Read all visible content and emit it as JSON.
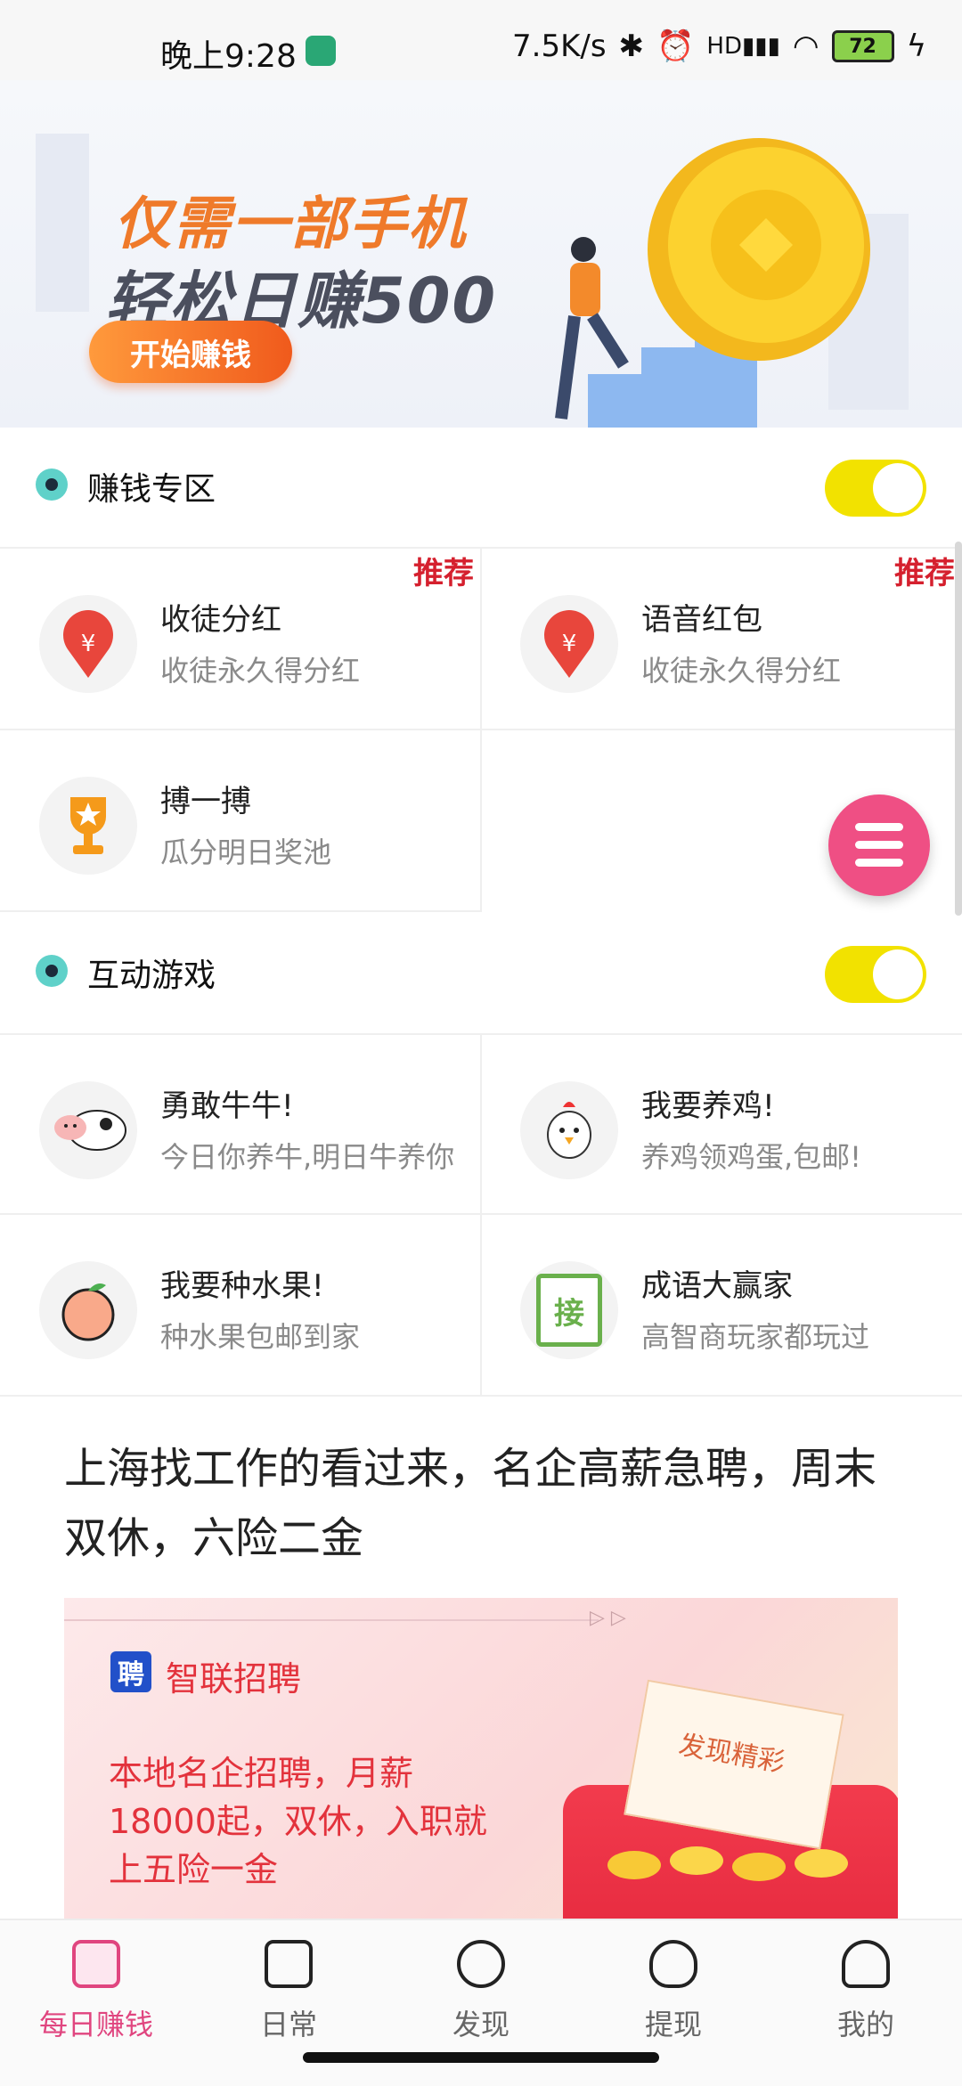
{
  "status_bar": {
    "time": "晚上9:28",
    "net_speed": "7.5K/s",
    "battery": "72",
    "indicators": [
      "bluetooth-icon",
      "alarm-icon",
      "hd-signal-icon",
      "wifi-icon",
      "charging-icon"
    ]
  },
  "banner": {
    "line1": "仅需一部手机",
    "line2": "轻松日赚500",
    "button_label": "开始赚钱"
  },
  "section_earn": {
    "title": "赚钱专区",
    "toggle_on": true,
    "items": [
      {
        "name": "收徒分红",
        "desc": "收徒永久得分红",
        "badge": "推荐",
        "icon": "money-bag-icon"
      },
      {
        "name": "语音红包",
        "desc": "收徒永久得分红",
        "badge": "推荐",
        "icon": "money-bag-icon"
      },
      {
        "name": "搏一搏",
        "desc": "瓜分明日奖池",
        "icon": "trophy-icon"
      }
    ]
  },
  "section_games": {
    "title": "互动游戏",
    "toggle_on": true,
    "items": [
      {
        "name": "勇敢牛牛!",
        "desc": "今日你养牛,明日牛养你",
        "icon": "cow-icon"
      },
      {
        "name": "我要养鸡!",
        "desc": "养鸡领鸡蛋,包邮!",
        "icon": "chicken-icon"
      },
      {
        "name": "我要种水果!",
        "desc": "种水果包邮到家",
        "icon": "peach-icon"
      },
      {
        "name": "成语大赢家",
        "desc": "高智商玩家都玩过",
        "icon": "idiom-book-icon",
        "icon_char": "接"
      }
    ]
  },
  "article": {
    "title": "上海找工作的看过来，名企高薪急聘，周末双休，六险二金"
  },
  "ad": {
    "brand": "智联招聘",
    "logo_char": "聘",
    "text": "本地名企招聘，月薪18000起，双休，入职就上五险一金",
    "ticket_label": "发现精彩"
  },
  "nav": {
    "tabs": [
      {
        "label": "每日赚钱",
        "icon": "chart-icon",
        "active": true
      },
      {
        "label": "日常",
        "icon": "notebook-icon"
      },
      {
        "label": "发现",
        "icon": "chat-icon"
      },
      {
        "label": "提现",
        "icon": "yen-bag-icon"
      },
      {
        "label": "我的",
        "icon": "person-icon"
      }
    ]
  },
  "colors": {
    "accent_pink": "#e0457f",
    "toggle_yellow": "#f2e200",
    "badge_red": "#d5202e"
  }
}
